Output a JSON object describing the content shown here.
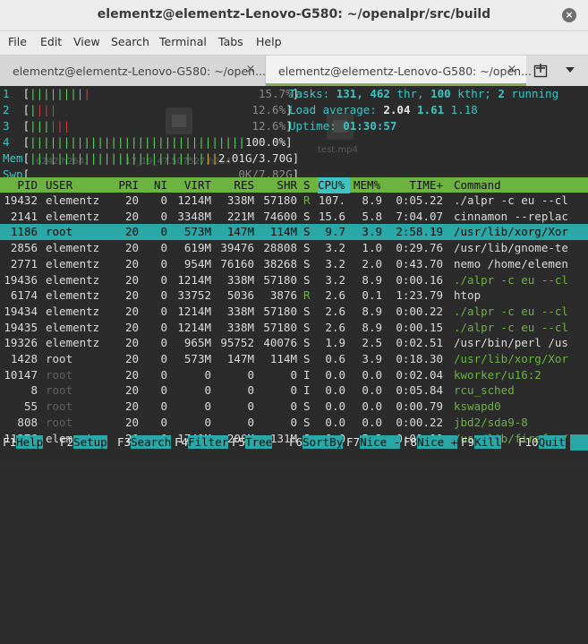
{
  "window": {
    "title": "elementz@elementz-Lenovo-G580: ~/openalpr/src/build",
    "close_glyph": "×"
  },
  "menu": [
    "File",
    "Edit",
    "View",
    "Search",
    "Terminal",
    "Tabs",
    "Help"
  ],
  "tabs": [
    {
      "label": "elementz@elementz-Lenovo-G580: ~/open...",
      "close": "×"
    },
    {
      "label": "elementz@elementz-Lenovo-G580: ~/open...",
      "close": "×"
    }
  ],
  "icons": {
    "new_tab": "new-tab-icon",
    "dropdown": "chevron-down-icon",
    "close": "close-icon"
  },
  "ghost_desktop": {
    "file1": "6242.h264.",
    "file2": "17_19_47.507527.h264",
    "file3": "test.mp4"
  },
  "meters": {
    "cpu": [
      {
        "label": "1",
        "bar_green": "||||||||",
        "bar_red": "|",
        "pct": "15.7%"
      },
      {
        "label": "2",
        "bar_green": "|",
        "bar_red": "|||",
        "pct": "12.6%"
      },
      {
        "label": "3",
        "bar_green": "|||",
        "bar_red": "|||",
        "pct": "12.6%"
      },
      {
        "label": "4",
        "bar_green": "||||||||||||||||||||||||||||||||",
        "bar_red": "",
        "pct": "100.0%"
      }
    ],
    "mem": {
      "label": "Mem",
      "bar_green": "||||||||||||||||||||||||||",
      "bar_yellow": "||",
      "value": "2.01G/3.70G"
    },
    "swp": {
      "label": "Swp",
      "value": "0K/7.82G"
    }
  },
  "summary": {
    "tasks_label": "Tasks:",
    "tasks": "131,",
    "thr": "462",
    "thr_label": "thr,",
    "kthr": "100",
    "kthr_label": "kthr;",
    "running": "2",
    "running_label": "running",
    "load_label": "Load average:",
    "load1": "2.04",
    "load5": "1.61",
    "load15": "1.18",
    "uptime_label": "Uptime:",
    "uptime": "01:30:57"
  },
  "columns": [
    "PID",
    "USER",
    "PRI",
    "NI",
    "VIRT",
    "RES",
    "SHR",
    "S",
    "CPU%",
    "MEM%",
    "TIME+",
    "Command"
  ],
  "processes": [
    {
      "pid": "19432",
      "user": "elementz",
      "pri": "20",
      "ni": "0",
      "virt": "1214M",
      "res": "338M",
      "shr": "57180",
      "s": "R",
      "cpu": "107.",
      "mem": "8.9",
      "time": "0:05.22",
      "cmd": "./alpr -c eu --cl",
      "style": "normal"
    },
    {
      "pid": "2141",
      "user": "elementz",
      "pri": "20",
      "ni": "0",
      "virt": "3348M",
      "res": "221M",
      "shr": "74600",
      "s": "S",
      "cpu": "15.6",
      "mem": "5.8",
      "time": "7:04.07",
      "cmd": "cinnamon --replac",
      "style": "normal"
    },
    {
      "pid": "1186",
      "user": "root",
      "pri": "20",
      "ni": "0",
      "virt": "573M",
      "res": "147M",
      "shr": "114M",
      "s": "S",
      "cpu": "9.7",
      "mem": "3.9",
      "time": "2:58.19",
      "cmd": "/usr/lib/xorg/Xor",
      "style": "selected"
    },
    {
      "pid": "2856",
      "user": "elementz",
      "pri": "20",
      "ni": "0",
      "virt": "619M",
      "res": "39476",
      "shr": "28808",
      "s": "S",
      "cpu": "3.2",
      "mem": "1.0",
      "time": "0:29.76",
      "cmd": "/usr/lib/gnome-te",
      "style": "normal"
    },
    {
      "pid": "2771",
      "user": "elementz",
      "pri": "20",
      "ni": "0",
      "virt": "954M",
      "res": "76160",
      "shr": "38268",
      "s": "S",
      "cpu": "3.2",
      "mem": "2.0",
      "time": "0:43.70",
      "cmd": "nemo /home/elemen",
      "style": "normal"
    },
    {
      "pid": "19436",
      "user": "elementz",
      "pri": "20",
      "ni": "0",
      "virt": "1214M",
      "res": "338M",
      "shr": "57180",
      "s": "S",
      "cpu": "3.2",
      "mem": "8.9",
      "time": "0:00.16",
      "cmd": "./alpr -c eu --cl",
      "style": "thread"
    },
    {
      "pid": "6174",
      "user": "elementz",
      "pri": "20",
      "ni": "0",
      "virt": "33752",
      "res": "5036",
      "shr": "3876",
      "s": "R",
      "cpu": "2.6",
      "mem": "0.1",
      "time": "1:23.79",
      "cmd": "htop",
      "style": "normal"
    },
    {
      "pid": "19434",
      "user": "elementz",
      "pri": "20",
      "ni": "0",
      "virt": "1214M",
      "res": "338M",
      "shr": "57180",
      "s": "S",
      "cpu": "2.6",
      "mem": "8.9",
      "time": "0:00.22",
      "cmd": "./alpr -c eu --cl",
      "style": "thread"
    },
    {
      "pid": "19435",
      "user": "elementz",
      "pri": "20",
      "ni": "0",
      "virt": "1214M",
      "res": "338M",
      "shr": "57180",
      "s": "S",
      "cpu": "2.6",
      "mem": "8.9",
      "time": "0:00.15",
      "cmd": "./alpr -c eu --cl",
      "style": "thread"
    },
    {
      "pid": "19326",
      "user": "elementz",
      "pri": "20",
      "ni": "0",
      "virt": "965M",
      "res": "95752",
      "shr": "40076",
      "s": "S",
      "cpu": "1.9",
      "mem": "2.5",
      "time": "0:02.51",
      "cmd": "/usr/bin/perl /us",
      "style": "normal"
    },
    {
      "pid": "1428",
      "user": "root",
      "pri": "20",
      "ni": "0",
      "virt": "573M",
      "res": "147M",
      "shr": "114M",
      "s": "S",
      "cpu": "0.6",
      "mem": "3.9",
      "time": "0:18.30",
      "cmd": "/usr/lib/xorg/Xor",
      "style": "thread"
    },
    {
      "pid": "10147",
      "user": "root",
      "pri": "20",
      "ni": "0",
      "virt": "0",
      "res": "0",
      "shr": "0",
      "s": "I",
      "cpu": "0.0",
      "mem": "0.0",
      "time": "0:02.04",
      "cmd": "kworker/u16:2",
      "style": "kernel"
    },
    {
      "pid": "8",
      "user": "root",
      "pri": "20",
      "ni": "0",
      "virt": "0",
      "res": "0",
      "shr": "0",
      "s": "I",
      "cpu": "0.0",
      "mem": "0.0",
      "time": "0:05.84",
      "cmd": "rcu_sched",
      "style": "kernel"
    },
    {
      "pid": "55",
      "user": "root",
      "pri": "20",
      "ni": "0",
      "virt": "0",
      "res": "0",
      "shr": "0",
      "s": "S",
      "cpu": "0.0",
      "mem": "0.0",
      "time": "0:00.79",
      "cmd": "kswapd0",
      "style": "kernel"
    },
    {
      "pid": "808",
      "user": "root",
      "pri": "20",
      "ni": "0",
      "virt": "0",
      "res": "0",
      "shr": "0",
      "s": "S",
      "cpu": "0.0",
      "mem": "0.0",
      "time": "0:00.22",
      "cmd": "jbd2/sda9-8",
      "style": "kernel"
    },
    {
      "pid": "11376",
      "user": "elementz",
      "pri": "20",
      "ni": "0",
      "virt": "1741M",
      "res": "200M",
      "shr": "131M",
      "s": "S",
      "cpu": "0.0",
      "mem": "5.3",
      "time": "0:00.99",
      "cmd": "/usr/lib/firefox/",
      "style": "thread"
    }
  ],
  "function_keys": [
    {
      "key": "F1",
      "label": "Help"
    },
    {
      "key": "F2",
      "label": "Setup"
    },
    {
      "key": "F3",
      "label": "Search"
    },
    {
      "key": "F4",
      "label": "Filter"
    },
    {
      "key": "F5",
      "label": "Tree"
    },
    {
      "key": "F6",
      "label": "SortBy"
    },
    {
      "key": "F7",
      "label": "Nice -"
    },
    {
      "key": "F8",
      "label": "Nice +"
    },
    {
      "key": "F9",
      "label": "Kill"
    },
    {
      "key": "F10",
      "label": "Quit"
    }
  ]
}
